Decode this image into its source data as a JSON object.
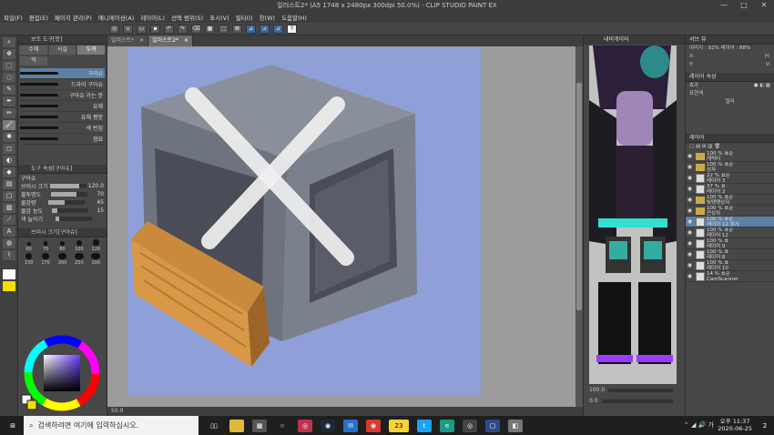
{
  "window": {
    "title": "일러스트2* (A5 1748 x 2480px 300dpi 50.0%) - CLIP STUDIO PAINT EX",
    "controls": [
      "—",
      "□",
      "✕"
    ]
  },
  "menu": [
    "파일(F)",
    "편집(E)",
    "페이지 관리(P)",
    "애니메이션(A)",
    "레이어(L)",
    "선택 범위(S)",
    "표시(V)",
    "필터(I)",
    "창(W)",
    "도움말(H)"
  ],
  "left_panel": {
    "header": "보조 도구[붓]",
    "tabs": [
      "수채",
      "사실",
      "두꺼"
    ],
    "tab_selected": 2,
    "tab2": "먹",
    "brushes": [
      {
        "label": "구아슈",
        "selected": true
      },
      {
        "label": "드라이 구아슈",
        "selected": false
      },
      {
        "label": "구아슈 가는 붓",
        "selected": false
      },
      {
        "label": "유채",
        "selected": false
      },
      {
        "label": "유채 평붓",
        "selected": false
      },
      {
        "label": "색 번짐",
        "selected": false
      },
      {
        "label": "점묘",
        "selected": false
      }
    ],
    "props_header": "도구 속성[구아슈]",
    "props_title": "구아슈",
    "props": [
      {
        "label": "브러시 크기",
        "value": "120.0",
        "fill": 0.8
      },
      {
        "label": "불투명도",
        "value": "70",
        "fill": 0.7
      },
      {
        "label": "물감량",
        "value": "45",
        "fill": 0.45
      },
      {
        "label": "물감 농도",
        "value": "15",
        "fill": 0.15
      },
      {
        "label": "색 늘이기",
        "value": "",
        "fill": 0.1
      }
    ],
    "size_header": "브러시 크기[구아슈]",
    "sizes": [
      "60",
      "70",
      "80",
      "100",
      "120",
      "150",
      "170",
      "200",
      "250",
      "300"
    ],
    "color_values": [
      "50.0"
    ]
  },
  "doc_tabs": [
    "일러스트*",
    "일러스트2*"
  ],
  "canvas_status": "50.0",
  "navigator": {
    "header": "내비게이터",
    "zoom": "100.0",
    "angle": "0.0"
  },
  "right_panel": {
    "info_header": "서브 뷰",
    "info_lines": [
      {
        "k": "X:",
        "v": "H:"
      },
      {
        "k": "Y:",
        "v": "V:"
      }
    ],
    "info_zoom": "이미지 : 92%  레이어 : 88%",
    "layer_prop_header": "레이어 속성",
    "effect_label": "효과",
    "expression_label": "표현색",
    "expression_value": "컬러",
    "layer_header": "레이어",
    "layers": [
      {
        "name": "100 % 표준\n캐릭터",
        "type": "folder",
        "sel": false
      },
      {
        "name": "100 % 표준\n상자",
        "type": "folder",
        "sel": false
      },
      {
        "name": "22 % 표준\n레이어 3",
        "type": "layer",
        "sel": false
      },
      {
        "name": "37 % 표\n레이어 2",
        "type": "layer",
        "sel": false
      },
      {
        "name": "100 % 표준\n빛땡땡상자",
        "type": "folder",
        "sel": false
      },
      {
        "name": "100 % 표준\n큰상자",
        "type": "folder",
        "sel": false
      },
      {
        "name": "100 % 표준\n레이어 12 복사",
        "type": "layer",
        "sel": true
      },
      {
        "name": "100 % 표준\n레이어 12",
        "type": "layer",
        "sel": false
      },
      {
        "name": "100 % 표\n레이어 9",
        "type": "layer",
        "sel": false
      },
      {
        "name": "100 % 표\n레이어 8",
        "type": "layer",
        "sel": false
      },
      {
        "name": "100 % 표\n레이어 10",
        "type": "layer",
        "sel": false
      },
      {
        "name": "14 % 표준\nCamScanner",
        "type": "layer",
        "sel": false
      }
    ]
  },
  "taskbar": {
    "search_placeholder": "검색하려면 여기에 입력하십시오.",
    "badge": "23",
    "time": "오후 11:37",
    "date": "2020-06-25",
    "notify": "2"
  },
  "colors": {
    "canvas_bg": "#8fa0d8",
    "selection": "#5d7fa3"
  }
}
